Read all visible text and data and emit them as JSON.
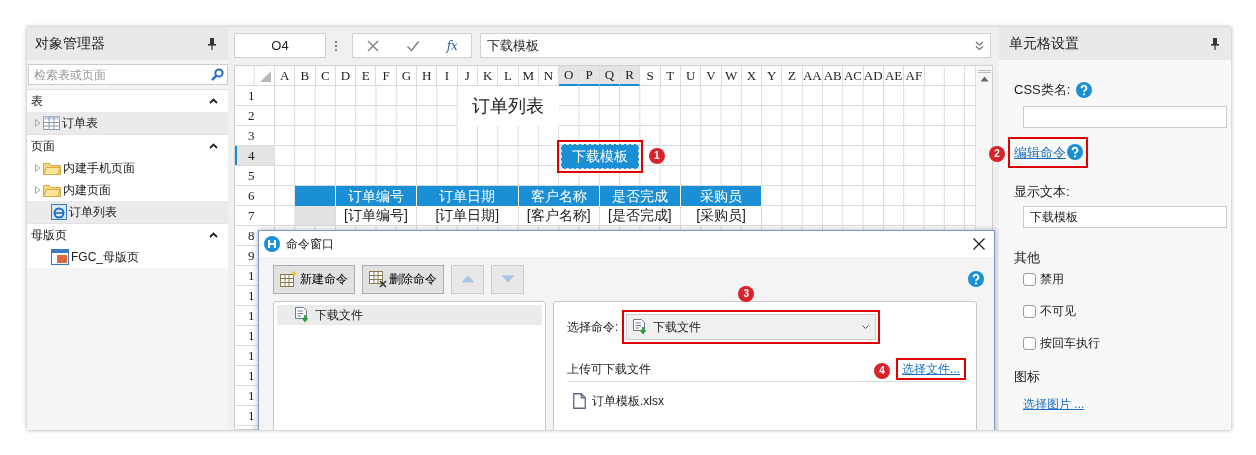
{
  "left_panel": {
    "title": "对象管理器",
    "search": {
      "placeholder": "检索表或页面"
    },
    "sections": [
      {
        "title": "表",
        "expanded": true,
        "items": [
          {
            "label": "订单表",
            "kind": "table",
            "expandable": true,
            "selected": true
          }
        ]
      },
      {
        "title": "页面",
        "expanded": true,
        "items": [
          {
            "label": "内建手机页面",
            "kind": "folder",
            "expandable": true,
            "selected": false
          },
          {
            "label": "内建页面",
            "kind": "folder",
            "expandable": true,
            "selected": false
          },
          {
            "label": "订单列表",
            "kind": "page",
            "expandable": false,
            "selected": true
          }
        ]
      },
      {
        "title": "母版页",
        "expanded": true,
        "items": [
          {
            "label": "FGC_母版页",
            "kind": "master",
            "expandable": false,
            "selected": false
          }
        ]
      }
    ]
  },
  "formula_bar": {
    "cell_name": "O4",
    "function_label": "fx",
    "formula": "下载模板"
  },
  "sheet": {
    "columns": [
      {
        "label": "A",
        "selected": false
      },
      {
        "label": "B",
        "selected": false
      },
      {
        "label": "C",
        "selected": false
      },
      {
        "label": "D",
        "selected": false
      },
      {
        "label": "E",
        "selected": false
      },
      {
        "label": "F",
        "selected": false
      },
      {
        "label": "G",
        "selected": false
      },
      {
        "label": "H",
        "selected": false
      },
      {
        "label": "I",
        "selected": false
      },
      {
        "label": "J",
        "selected": false
      },
      {
        "label": "K",
        "selected": false
      },
      {
        "label": "L",
        "selected": false
      },
      {
        "label": "M",
        "selected": false
      },
      {
        "label": "N",
        "selected": false
      },
      {
        "label": "O",
        "selected": true
      },
      {
        "label": "P",
        "selected": true
      },
      {
        "label": "Q",
        "selected": true
      },
      {
        "label": "R",
        "selected": true
      },
      {
        "label": "S",
        "selected": false
      },
      {
        "label": "T",
        "selected": false
      },
      {
        "label": "U",
        "selected": false
      },
      {
        "label": "V",
        "selected": false
      },
      {
        "label": "W",
        "selected": false
      },
      {
        "label": "X",
        "selected": false
      },
      {
        "label": "Y",
        "selected": false
      },
      {
        "label": "Z",
        "selected": false
      },
      {
        "label": "AA",
        "selected": false
      },
      {
        "label": "AB",
        "selected": false
      },
      {
        "label": "AC",
        "selected": false
      },
      {
        "label": "AD",
        "selected": false
      },
      {
        "label": "AE",
        "selected": false
      },
      {
        "label": "AF",
        "selected": false
      }
    ],
    "rows": [
      {
        "label": "1",
        "selected": false
      },
      {
        "label": "2",
        "selected": false
      },
      {
        "label": "3",
        "selected": false
      },
      {
        "label": "4",
        "selected": true
      },
      {
        "label": "5",
        "selected": false
      },
      {
        "label": "6",
        "selected": false
      },
      {
        "label": "7",
        "selected": false
      },
      {
        "label": "8",
        "selected": false
      },
      {
        "label": "9",
        "selected": false
      },
      {
        "label": "1",
        "selected": false
      },
      {
        "label": "1",
        "selected": false
      },
      {
        "label": "1",
        "selected": false
      },
      {
        "label": "1",
        "selected": false
      },
      {
        "label": "1",
        "selected": false
      },
      {
        "label": "1",
        "selected": false
      },
      {
        "label": "1",
        "selected": false
      },
      {
        "label": "1",
        "selected": false
      }
    ],
    "cells": [
      {
        "kind": "title",
        "text": "订单列表"
      },
      {
        "kind": "button",
        "text": "下载模板",
        "callout": "1"
      },
      {
        "kind": "header"
      },
      {
        "kind": "header",
        "text": "订单编号"
      },
      {
        "kind": "header",
        "text": "订单日期"
      },
      {
        "kind": "header",
        "text": "客户名称"
      },
      {
        "kind": "header",
        "text": "是否完成"
      },
      {
        "kind": "header",
        "text": "采购员"
      },
      {
        "kind": "blank"
      },
      {
        "kind": "field",
        "text": "[订单编号]"
      },
      {
        "kind": "field",
        "text": "[订单日期]"
      },
      {
        "kind": "field",
        "text": "[客户名称]"
      },
      {
        "kind": "field",
        "text": "[是否完成]"
      },
      {
        "kind": "field",
        "text": "[采购员]"
      }
    ]
  },
  "command_window": {
    "title": "命令窗口",
    "buttons": [
      {
        "kind": "new",
        "label": "新建命令",
        "disabled": false
      },
      {
        "kind": "delete",
        "label": "删除命令",
        "disabled": false
      },
      {
        "kind": "up",
        "disabled": true
      },
      {
        "kind": "down",
        "disabled": true
      }
    ],
    "commands": [
      {
        "label": "下载文件",
        "selected": true
      }
    ],
    "select_label": "选择命令:",
    "selected_command": {
      "value": "下载文件",
      "callout": "3"
    },
    "upload_label": "上传可下载文件",
    "upload_link": {
      "label": "选择文件...",
      "callout": "4"
    },
    "files": [
      "订单模板.xlsx"
    ]
  },
  "right_panel": {
    "title": "单元格设置",
    "css_label": "CSS类名:",
    "command_link": {
      "label": "编辑命令",
      "callout": "2"
    },
    "display_label": "显示文本:",
    "display_value": "下载模板",
    "other_title": "其他",
    "options": [
      {
        "label": "禁用",
        "checked": false
      },
      {
        "label": "不可见",
        "checked": false
      },
      {
        "label": "按回车执行",
        "checked": false
      }
    ],
    "icon_title": "图标",
    "icon_link": "选择图片 ..."
  }
}
